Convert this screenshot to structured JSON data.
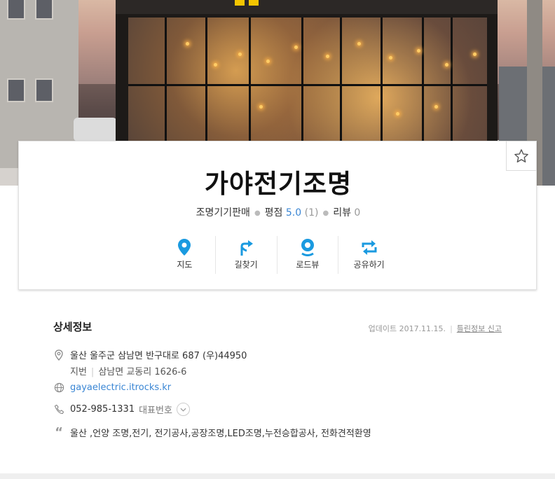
{
  "place": {
    "name": "가야전기조명",
    "category": "조명기기판매",
    "rating_label": "평점",
    "rating": "5.0",
    "rating_count": "(1)",
    "review_label": "리뷰",
    "review_count": "0"
  },
  "actions": [
    {
      "label": "지도",
      "icon": "map-pin-icon"
    },
    {
      "label": "길찾기",
      "icon": "directions-icon"
    },
    {
      "label": "로드뷰",
      "icon": "roadview-icon"
    },
    {
      "label": "공유하기",
      "icon": "share-icon"
    }
  ],
  "detail": {
    "title": "상세정보",
    "update_text": "업데이트 2017.11.15.",
    "report_label": "틀린정보 신고",
    "address": "울산 울주군 삼남면 반구대로 687 (우)44950",
    "jibun_label": "지번",
    "jibun": "삼남면 교동리 1626-6",
    "website": "gayaelectric.itrocks.kr",
    "phone": "052-985-1331",
    "phone_label": "대표번호",
    "keywords": "울산 ,언양 조명,전기, 전기공사,공장조명,LED조명,누전승합공사, 전화견적환영"
  },
  "colors": {
    "accent": "#1a9ae0",
    "link": "#3a86d4"
  }
}
